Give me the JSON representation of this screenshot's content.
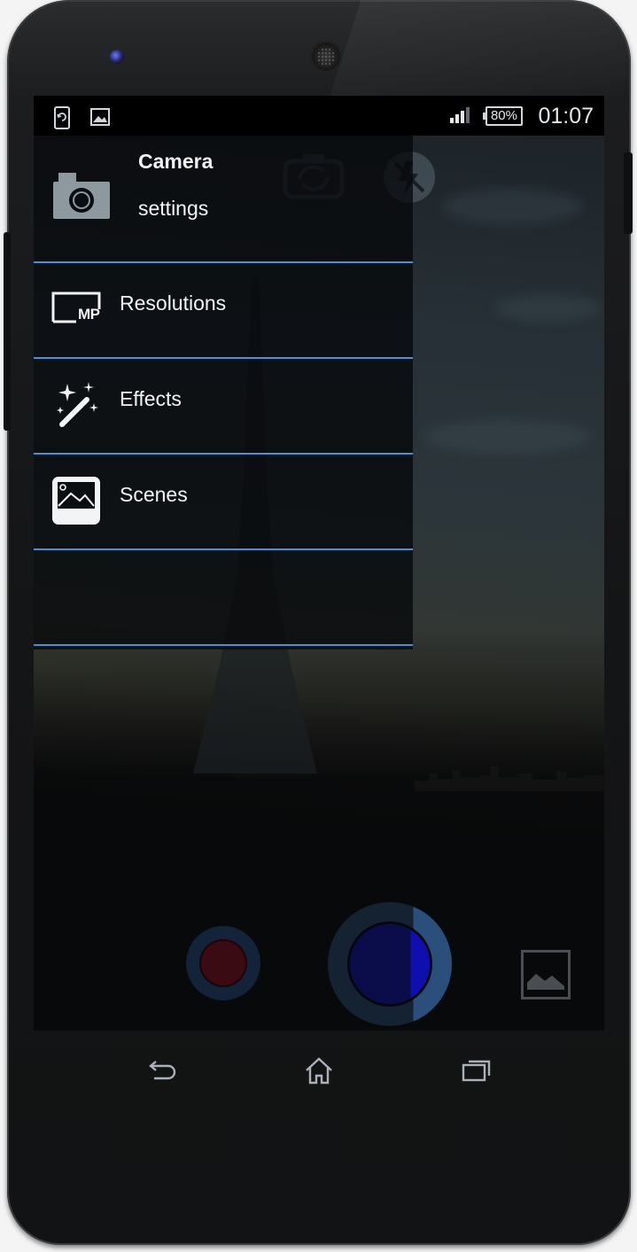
{
  "status_bar": {
    "battery": "80%",
    "time": "01:07"
  },
  "drawer": {
    "title_line1": "Camera",
    "title_line2": "settings",
    "items": [
      {
        "label": "Resolutions",
        "icon": "resolution-mp-icon",
        "icon_text": "MP"
      },
      {
        "label": "Effects",
        "icon": "magic-wand-icon"
      },
      {
        "label": "Scenes",
        "icon": "landscape-icon"
      }
    ]
  },
  "colors": {
    "divider": "#4b8fd4",
    "shutter_outer": "#152232",
    "shutter_inner": "#0b0d4a"
  }
}
